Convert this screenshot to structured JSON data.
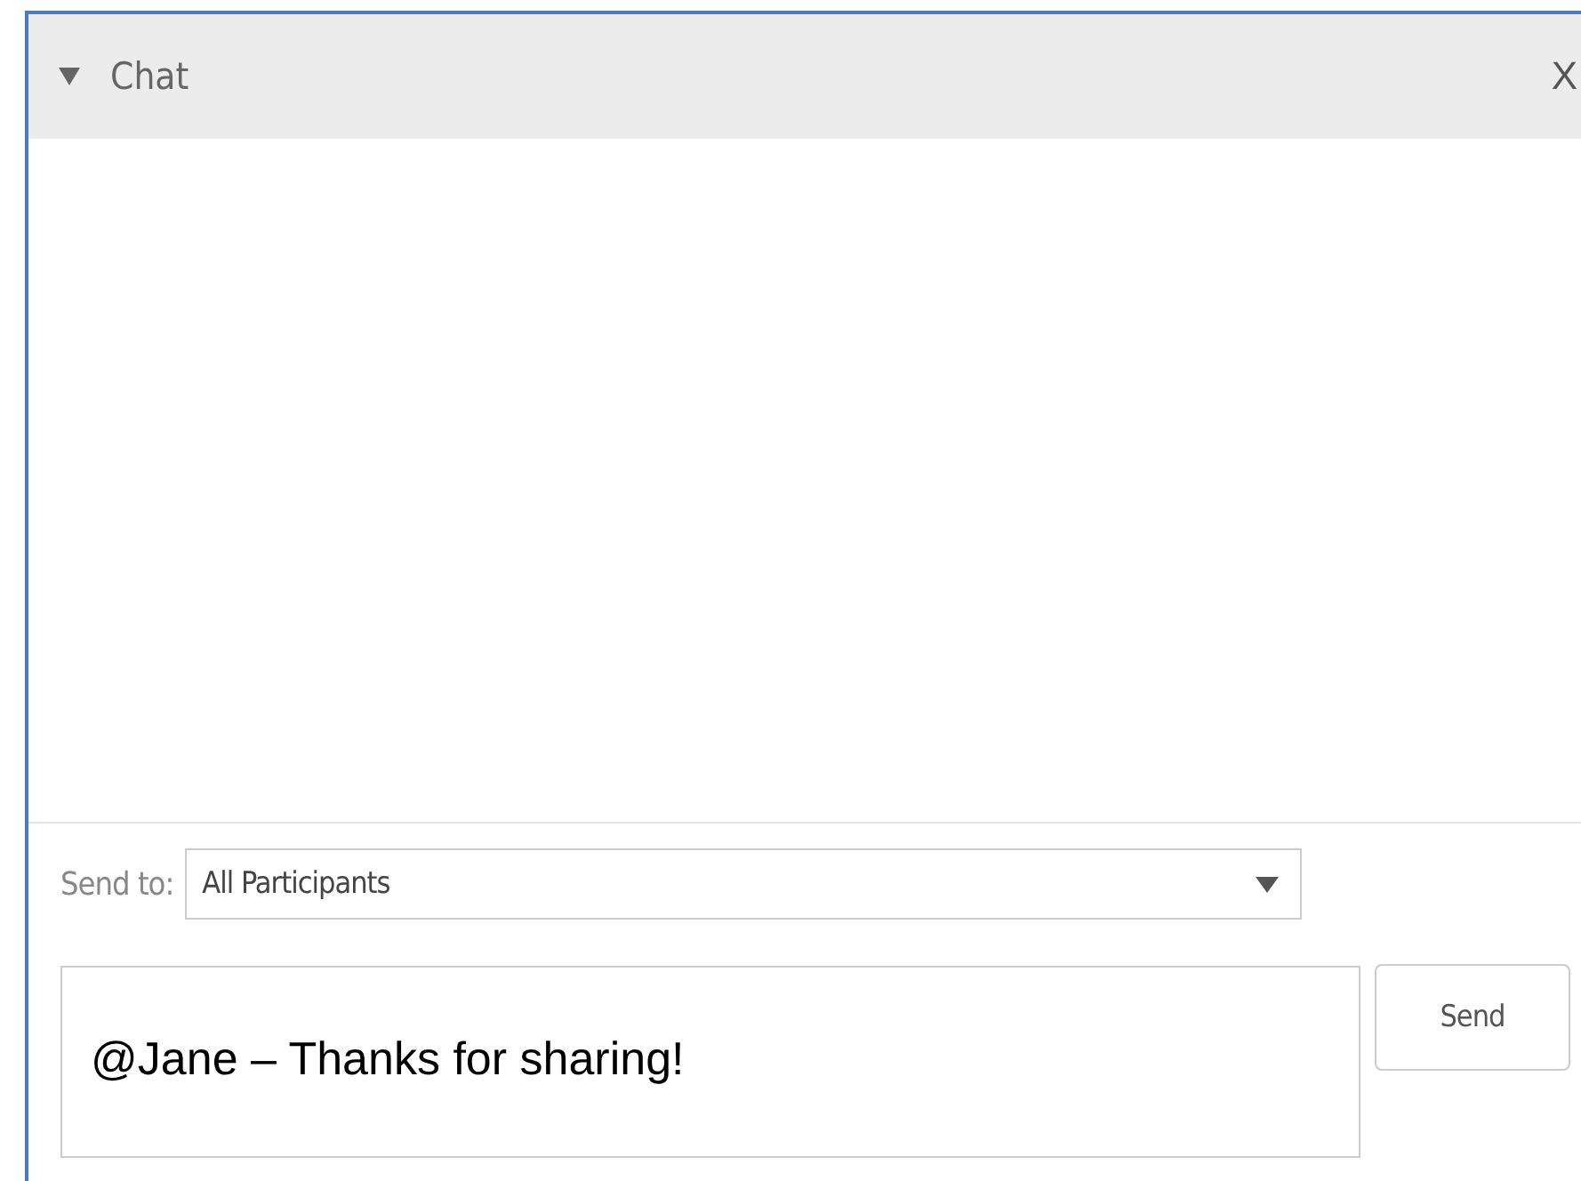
{
  "panel": {
    "title": "Chat",
    "expanded": true,
    "close": "X"
  },
  "send_to": {
    "label": "Send to:",
    "value": "All Participants"
  },
  "message": {
    "value": "@Jane – Thanks for sharing!"
  },
  "buttons": [
    "Send"
  ]
}
